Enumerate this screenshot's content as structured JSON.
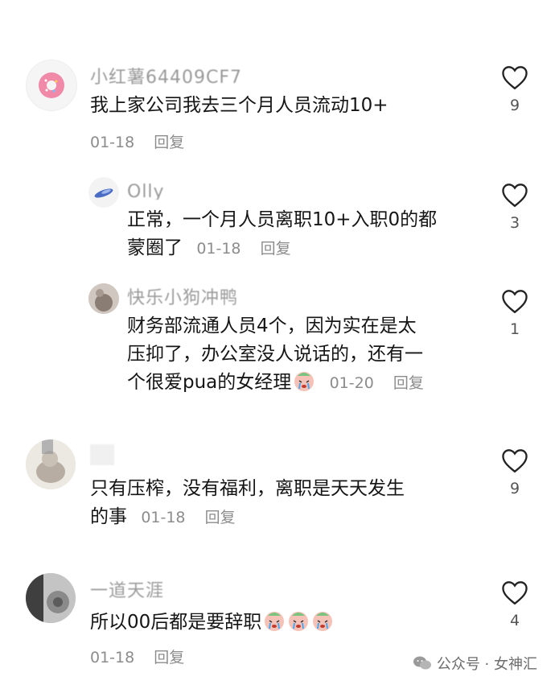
{
  "comments": [
    {
      "username": "小红薯64409CF7",
      "text_lines": [
        "我上家公司我去三个月人员流动10+"
      ],
      "date": "01-18",
      "reply_label": "回复",
      "likes": "9",
      "avatar_icon": "donut-icon"
    },
    {
      "username": "Olly",
      "text_lines": [
        "正常，一个月人员离职10+入职0的都",
        "蒙圈了"
      ],
      "date": "01-18",
      "reply_label": "回复",
      "likes": "3",
      "avatar_icon": "avatar-image"
    },
    {
      "username": "快乐小狗冲鸭",
      "text_lines": [
        "财务部流通人员4个，因为实在是太",
        "压抑了，办公室没人说话的，还有一",
        "个很爱pua的女经理"
      ],
      "date": "01-20",
      "reply_label": "回复",
      "likes": "1",
      "avatar_icon": "avatar-image"
    },
    {
      "username": "",
      "text_lines": [
        "只有压榨，没有福利，离职是天天发生",
        "的事"
      ],
      "date": "01-18",
      "reply_label": "回复",
      "likes": "9",
      "avatar_icon": "avatar-image"
    },
    {
      "username": "一道天涯",
      "text_lines": [
        "所以00后都是要辞职"
      ],
      "date": "01-18",
      "reply_label": "回复",
      "likes": "4",
      "avatar_icon": "avatar-image"
    }
  ],
  "watermark": {
    "text": "公众号 · 女神汇",
    "icon": "wechat-icon"
  },
  "colors": {
    "meta_gray": "#8c8c8c",
    "text_dark": "#151515",
    "emoji_pink": "#f2b6b6"
  }
}
